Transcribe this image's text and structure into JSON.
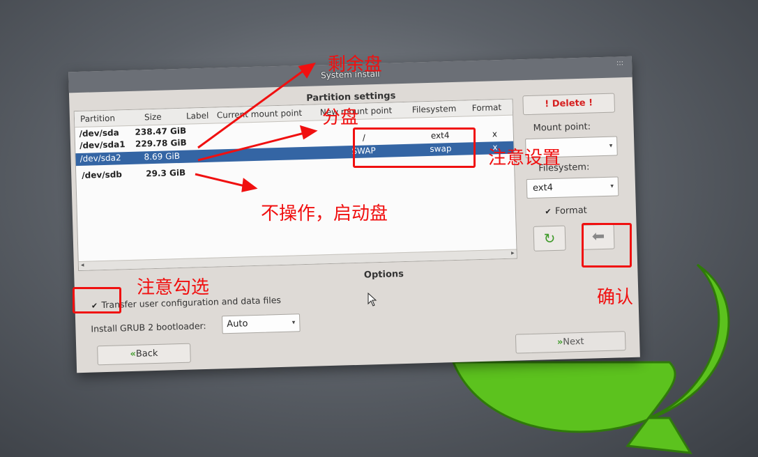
{
  "window": {
    "title": "System install",
    "partition_settings_title": "Partition settings",
    "options_title": "Options"
  },
  "table": {
    "columns": [
      "Partition",
      "Size",
      "Label",
      "Current mount point",
      "New mount point",
      "Filesystem",
      "Format"
    ],
    "rows": [
      {
        "partition": "/dev/sda",
        "size": "238.47 GiB",
        "new_mount": "",
        "filesystem": "",
        "format": "",
        "selected": false
      },
      {
        "partition": "/dev/sda1",
        "size": "229.78 GiB",
        "new_mount": "/",
        "filesystem": "ext4",
        "format": "x",
        "selected": false
      },
      {
        "partition": "/dev/sda2",
        "size": "8.69 GiB",
        "new_mount": "SWAP",
        "filesystem": "swap",
        "format": "x",
        "selected": true
      },
      {
        "partition": "/dev/sdb",
        "size": "29.3 GiB",
        "new_mount": "",
        "filesystem": "",
        "format": "",
        "selected": false
      }
    ]
  },
  "right_panel": {
    "delete_label": "! Delete !",
    "mount_point_label": "Mount point:",
    "mount_point_value": "",
    "filesystem_label": "Filesystem:",
    "filesystem_value": "ext4",
    "format_label": "Format",
    "format_checked": true
  },
  "options": {
    "transfer_label": "Transfer user configuration and data files",
    "transfer_checked": true,
    "grub_label": "Install GRUB 2 bootloader:",
    "grub_value": "Auto"
  },
  "nav": {
    "back_label": "Back",
    "next_label": "Next"
  },
  "annotations": {
    "remaining_disk": "剩余盘",
    "partition_disk": "分盘",
    "note_settings": "注意设置",
    "no_operation_boot": "不操作，启动盘",
    "note_check": "注意勾选",
    "confirm": "确认"
  },
  "colors": {
    "annotation": "#f01010",
    "selection": "#3465a4",
    "swoosh": "#5cc21e"
  },
  "icons": {
    "refresh": "refresh-icon",
    "apply": "arrow-left-icon",
    "back": "double-chevron-left-icon",
    "next": "double-chevron-right-icon"
  }
}
